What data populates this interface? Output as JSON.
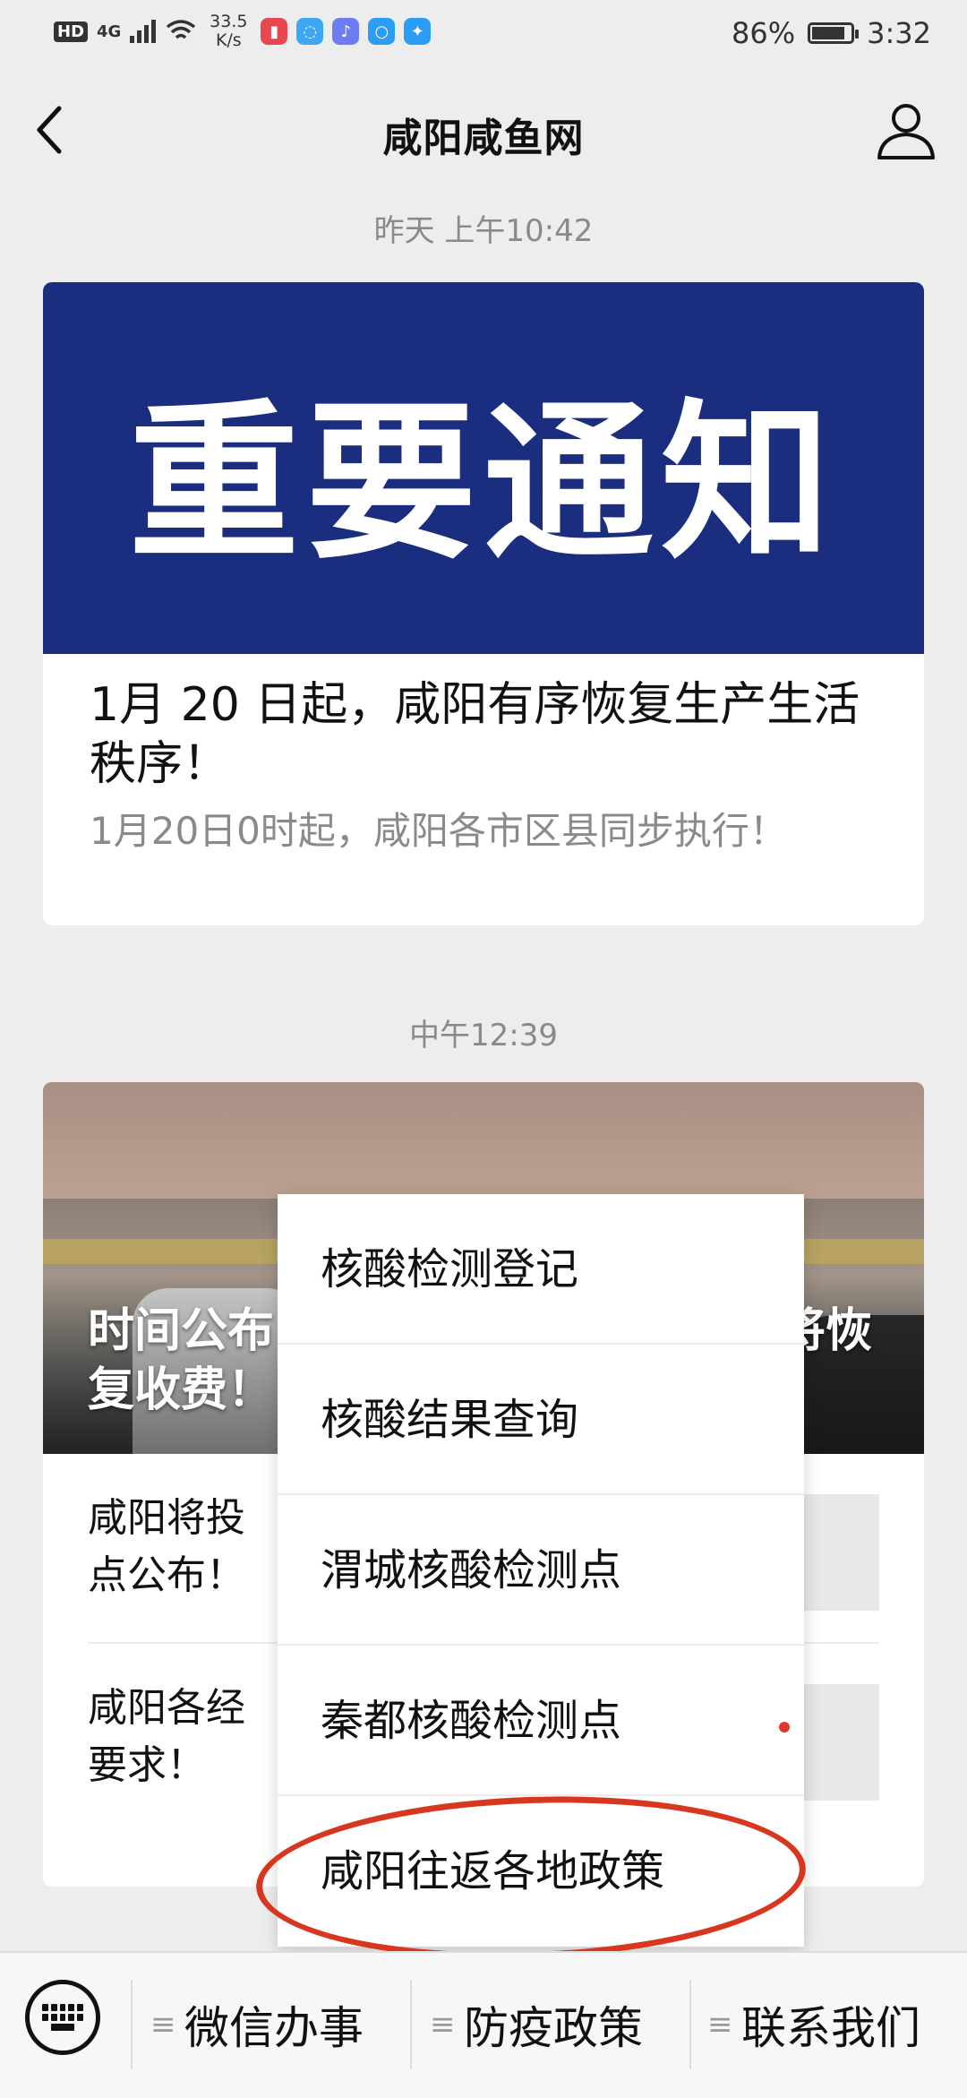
{
  "status_bar": {
    "hd": "HD",
    "signal": "4G",
    "speed": "33.5\nK/s",
    "battery": "86%",
    "battery_level": 0.86,
    "time": "3:32"
  },
  "nav": {
    "title": "咸阳咸鱼网",
    "back_icon": "chevron-left-icon",
    "profile_icon": "user-icon"
  },
  "messages": [
    {
      "timestamp": "昨天 上午10:42",
      "banner_text": "重要通知",
      "title": "1月 20 日起，咸阳有序恢复生产生活秩序！",
      "desc": "1月20日0时起，咸阳各市区县同步执行！"
    },
    {
      "timestamp": "中午12:39",
      "banner_title_left": "时间公布",
      "banner_title_right": "将恢",
      "banner_title_line2": "复收费！",
      "sub_items": [
        {
          "line1": "咸阳将投",
          "line2": "点公布！"
        },
        {
          "line1": "咸阳各经",
          "line2": "要求！"
        }
      ]
    }
  ],
  "popup_menu": {
    "items": [
      "核酸检测登记",
      "核酸结果查询",
      "渭城核酸检测点",
      "秦都核酸检测点",
      "咸阳往返各地政策"
    ],
    "highlight_color": "#d7371f"
  },
  "bottom_menu": {
    "keyboard_icon": "keyboard-icon",
    "tabs": [
      "微信办事",
      "防疫政策",
      "联系我们"
    ]
  }
}
